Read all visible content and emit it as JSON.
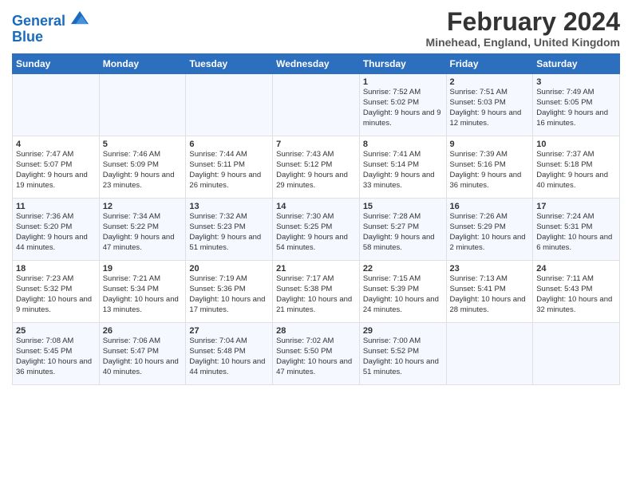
{
  "logo": {
    "line1": "General",
    "line2": "Blue"
  },
  "title": "February 2024",
  "subtitle": "Minehead, England, United Kingdom",
  "headers": [
    "Sunday",
    "Monday",
    "Tuesday",
    "Wednesday",
    "Thursday",
    "Friday",
    "Saturday"
  ],
  "weeks": [
    [
      {
        "day": "",
        "sunrise": "",
        "sunset": "",
        "daylight": ""
      },
      {
        "day": "",
        "sunrise": "",
        "sunset": "",
        "daylight": ""
      },
      {
        "day": "",
        "sunrise": "",
        "sunset": "",
        "daylight": ""
      },
      {
        "day": "",
        "sunrise": "",
        "sunset": "",
        "daylight": ""
      },
      {
        "day": "1",
        "sunrise": "Sunrise: 7:52 AM",
        "sunset": "Sunset: 5:02 PM",
        "daylight": "Daylight: 9 hours and 9 minutes."
      },
      {
        "day": "2",
        "sunrise": "Sunrise: 7:51 AM",
        "sunset": "Sunset: 5:03 PM",
        "daylight": "Daylight: 9 hours and 12 minutes."
      },
      {
        "day": "3",
        "sunrise": "Sunrise: 7:49 AM",
        "sunset": "Sunset: 5:05 PM",
        "daylight": "Daylight: 9 hours and 16 minutes."
      }
    ],
    [
      {
        "day": "4",
        "sunrise": "Sunrise: 7:47 AM",
        "sunset": "Sunset: 5:07 PM",
        "daylight": "Daylight: 9 hours and 19 minutes."
      },
      {
        "day": "5",
        "sunrise": "Sunrise: 7:46 AM",
        "sunset": "Sunset: 5:09 PM",
        "daylight": "Daylight: 9 hours and 23 minutes."
      },
      {
        "day": "6",
        "sunrise": "Sunrise: 7:44 AM",
        "sunset": "Sunset: 5:11 PM",
        "daylight": "Daylight: 9 hours and 26 minutes."
      },
      {
        "day": "7",
        "sunrise": "Sunrise: 7:43 AM",
        "sunset": "Sunset: 5:12 PM",
        "daylight": "Daylight: 9 hours and 29 minutes."
      },
      {
        "day": "8",
        "sunrise": "Sunrise: 7:41 AM",
        "sunset": "Sunset: 5:14 PM",
        "daylight": "Daylight: 9 hours and 33 minutes."
      },
      {
        "day": "9",
        "sunrise": "Sunrise: 7:39 AM",
        "sunset": "Sunset: 5:16 PM",
        "daylight": "Daylight: 9 hours and 36 minutes."
      },
      {
        "day": "10",
        "sunrise": "Sunrise: 7:37 AM",
        "sunset": "Sunset: 5:18 PM",
        "daylight": "Daylight: 9 hours and 40 minutes."
      }
    ],
    [
      {
        "day": "11",
        "sunrise": "Sunrise: 7:36 AM",
        "sunset": "Sunset: 5:20 PM",
        "daylight": "Daylight: 9 hours and 44 minutes."
      },
      {
        "day": "12",
        "sunrise": "Sunrise: 7:34 AM",
        "sunset": "Sunset: 5:22 PM",
        "daylight": "Daylight: 9 hours and 47 minutes."
      },
      {
        "day": "13",
        "sunrise": "Sunrise: 7:32 AM",
        "sunset": "Sunset: 5:23 PM",
        "daylight": "Daylight: 9 hours and 51 minutes."
      },
      {
        "day": "14",
        "sunrise": "Sunrise: 7:30 AM",
        "sunset": "Sunset: 5:25 PM",
        "daylight": "Daylight: 9 hours and 54 minutes."
      },
      {
        "day": "15",
        "sunrise": "Sunrise: 7:28 AM",
        "sunset": "Sunset: 5:27 PM",
        "daylight": "Daylight: 9 hours and 58 minutes."
      },
      {
        "day": "16",
        "sunrise": "Sunrise: 7:26 AM",
        "sunset": "Sunset: 5:29 PM",
        "daylight": "Daylight: 10 hours and 2 minutes."
      },
      {
        "day": "17",
        "sunrise": "Sunrise: 7:24 AM",
        "sunset": "Sunset: 5:31 PM",
        "daylight": "Daylight: 10 hours and 6 minutes."
      }
    ],
    [
      {
        "day": "18",
        "sunrise": "Sunrise: 7:23 AM",
        "sunset": "Sunset: 5:32 PM",
        "daylight": "Daylight: 10 hours and 9 minutes."
      },
      {
        "day": "19",
        "sunrise": "Sunrise: 7:21 AM",
        "sunset": "Sunset: 5:34 PM",
        "daylight": "Daylight: 10 hours and 13 minutes."
      },
      {
        "day": "20",
        "sunrise": "Sunrise: 7:19 AM",
        "sunset": "Sunset: 5:36 PM",
        "daylight": "Daylight: 10 hours and 17 minutes."
      },
      {
        "day": "21",
        "sunrise": "Sunrise: 7:17 AM",
        "sunset": "Sunset: 5:38 PM",
        "daylight": "Daylight: 10 hours and 21 minutes."
      },
      {
        "day": "22",
        "sunrise": "Sunrise: 7:15 AM",
        "sunset": "Sunset: 5:39 PM",
        "daylight": "Daylight: 10 hours and 24 minutes."
      },
      {
        "day": "23",
        "sunrise": "Sunrise: 7:13 AM",
        "sunset": "Sunset: 5:41 PM",
        "daylight": "Daylight: 10 hours and 28 minutes."
      },
      {
        "day": "24",
        "sunrise": "Sunrise: 7:11 AM",
        "sunset": "Sunset: 5:43 PM",
        "daylight": "Daylight: 10 hours and 32 minutes."
      }
    ],
    [
      {
        "day": "25",
        "sunrise": "Sunrise: 7:08 AM",
        "sunset": "Sunset: 5:45 PM",
        "daylight": "Daylight: 10 hours and 36 minutes."
      },
      {
        "day": "26",
        "sunrise": "Sunrise: 7:06 AM",
        "sunset": "Sunset: 5:47 PM",
        "daylight": "Daylight: 10 hours and 40 minutes."
      },
      {
        "day": "27",
        "sunrise": "Sunrise: 7:04 AM",
        "sunset": "Sunset: 5:48 PM",
        "daylight": "Daylight: 10 hours and 44 minutes."
      },
      {
        "day": "28",
        "sunrise": "Sunrise: 7:02 AM",
        "sunset": "Sunset: 5:50 PM",
        "daylight": "Daylight: 10 hours and 47 minutes."
      },
      {
        "day": "29",
        "sunrise": "Sunrise: 7:00 AM",
        "sunset": "Sunset: 5:52 PM",
        "daylight": "Daylight: 10 hours and 51 minutes."
      },
      {
        "day": "",
        "sunrise": "",
        "sunset": "",
        "daylight": ""
      },
      {
        "day": "",
        "sunrise": "",
        "sunset": "",
        "daylight": ""
      }
    ]
  ]
}
